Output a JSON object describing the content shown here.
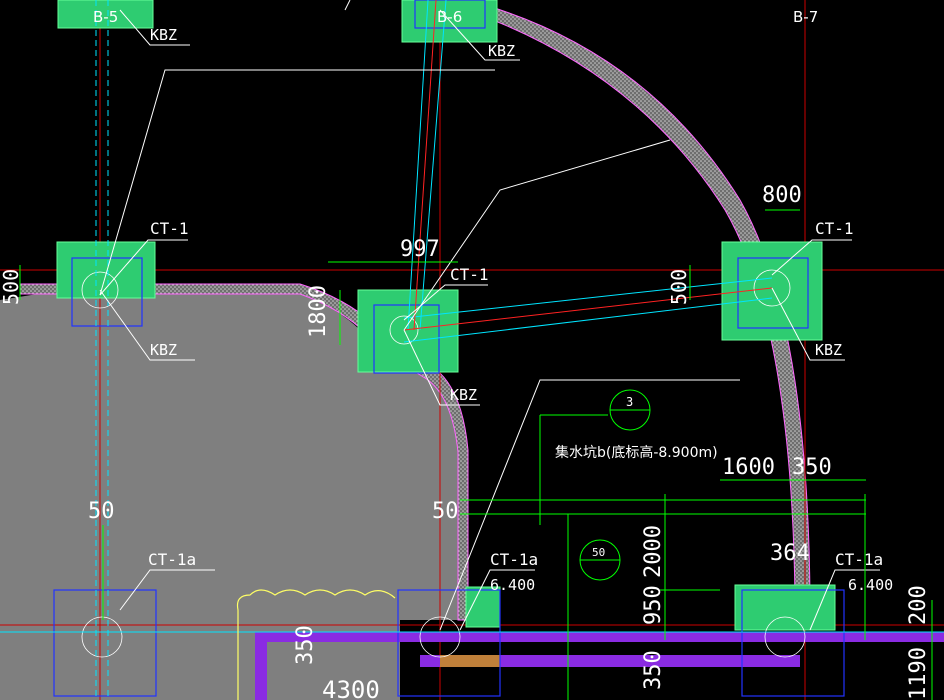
{
  "axis_labels": [
    "B-5",
    "B-6",
    "B-7"
  ],
  "column_labels": {
    "kbz_1": "KBZ",
    "kbz_2": "KBZ",
    "kbz_3": "KBZ",
    "kbz_4": "KBZ",
    "kbz_5": "KBZ"
  },
  "pile_cap_labels": {
    "ct1_left": "CT-1",
    "ct1_mid": "CT-1",
    "ct1_right": "CT-1",
    "ct1a_left": "CT-1a",
    "ct1a_mid": "CT-1a",
    "ct1a_right": "CT-1a"
  },
  "elevations": {
    "mid": "6.400",
    "right": "6.400"
  },
  "dimensions": {
    "d800": "800",
    "d997": "997",
    "d1800": "1800",
    "d500": "500",
    "d500_left": "500",
    "d50_left": "50",
    "d50_mid": "50",
    "d1600": "1600",
    "d350_top": "350",
    "d2000": "2000",
    "d364": "364",
    "d950": "950",
    "d350_bottom": "350",
    "d350_left": "350",
    "d200": "200",
    "d1190": "1190",
    "d4300": "4300"
  },
  "note": "集水坑b(底标高-8.900m)",
  "detail_markers": {
    "top": "3",
    "bottom": "50"
  },
  "colors": {
    "background": "#000000",
    "cap_fill": "#2ecc71",
    "slab_fill": "#7f7f7f",
    "grid_line": "#cc0000",
    "beam_purple": "#8a2be2",
    "outline_blue": "#0000ff",
    "dim_green": "#00ff00"
  }
}
